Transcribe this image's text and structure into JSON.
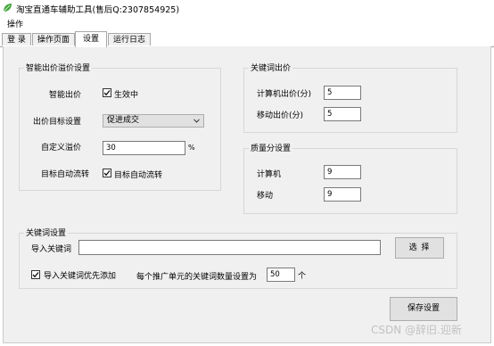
{
  "window": {
    "title": "淘宝直通车辅助工具(售后Q:2307854925)"
  },
  "menu": {
    "items": [
      "操作"
    ]
  },
  "tabs": [
    {
      "label": "登 录"
    },
    {
      "label": "操作页面"
    },
    {
      "label": "设置"
    },
    {
      "label": "运行日志"
    }
  ],
  "smart_bid": {
    "title": "智能出价溢价设置",
    "bid_label": "智能出价",
    "bid_checkbox_label": "生效中",
    "bid_checked": true,
    "target_label": "出价目标设置",
    "target_value": "促进成交",
    "premium_label": "自定义溢价",
    "premium_value": "30",
    "premium_unit": "%",
    "flow_label": "目标自动流转",
    "flow_checkbox_label": "目标自动流转",
    "flow_checked": true
  },
  "keyword_bid": {
    "title": "关键词出价",
    "pc_label": "计算机出价(分)",
    "pc_value": "5",
    "mobile_label": "移动出价(分)",
    "mobile_value": "5"
  },
  "quality": {
    "title": "质量分设置",
    "pc_label": "计算机",
    "pc_value": "9",
    "mobile_label": "移动",
    "mobile_value": "9"
  },
  "keyword_settings": {
    "title": "关键词设置",
    "import_label": "导入关键词",
    "import_value": "",
    "select_button": "选 择",
    "priority_label": "导入关键词优先添加",
    "priority_checked": true,
    "count_label": "每个推广单元的关键词数量设置为",
    "count_value": "50",
    "count_unit": "个"
  },
  "save_button": "保存设置",
  "watermark": "CSDN @辞旧.迎新",
  "colors": {
    "app_icon": "#3fa535",
    "panel": "#f0f0f0",
    "button": "#e1e1e1"
  }
}
